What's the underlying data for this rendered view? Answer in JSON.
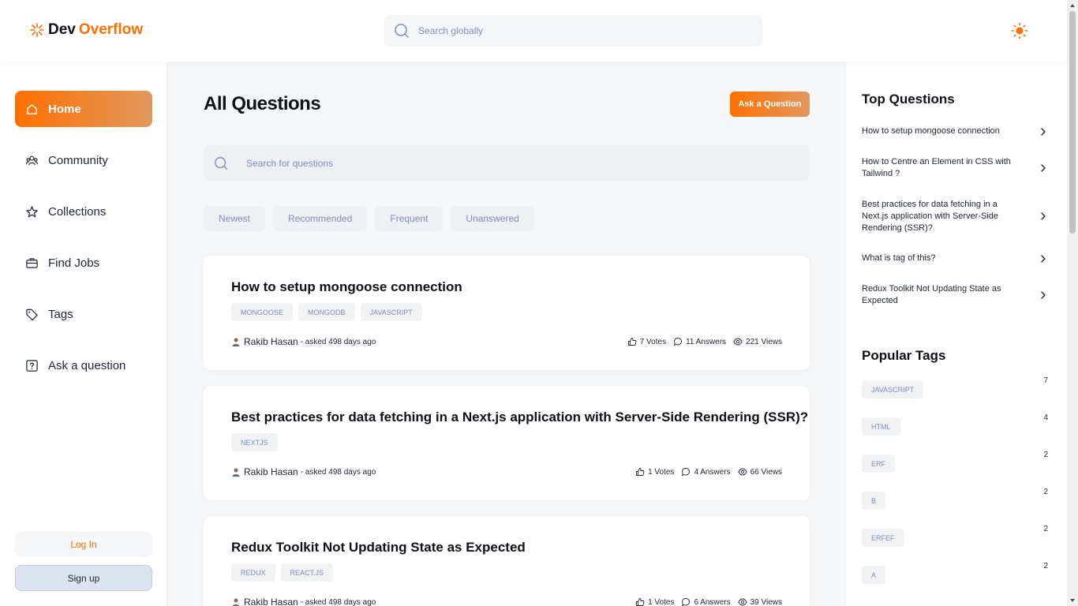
{
  "brand": {
    "part1": "Dev",
    "part2": "Overflow",
    "accent": "#ff7000"
  },
  "header": {
    "search_placeholder": "Search globally",
    "theme_icon": "sun-icon"
  },
  "sidebar": {
    "items": [
      {
        "label": "Home",
        "icon": "home-icon",
        "active": true
      },
      {
        "label": "Community",
        "icon": "users-icon"
      },
      {
        "label": "Collections",
        "icon": "star-icon"
      },
      {
        "label": "Find Jobs",
        "icon": "briefcase-icon"
      },
      {
        "label": "Tags",
        "icon": "tag-icon"
      },
      {
        "label": "Ask a question",
        "icon": "question-icon"
      }
    ],
    "login_label": "Log In",
    "signup_label": "Sign up"
  },
  "main": {
    "title": "All Questions",
    "ask_button": "Ask a Question",
    "search_placeholder": "Search for questions",
    "filters": [
      "Newest",
      "Recommended",
      "Frequent",
      "Unanswered"
    ],
    "questions": [
      {
        "title": "How to setup mongoose connection",
        "tags": [
          "MONGOOSE",
          "MONGODB",
          "JAVASCRIPT"
        ],
        "author": "Rakib Hasan",
        "asked": "- asked 498 days ago",
        "votes": "7 Votes",
        "answers": "11 Answers",
        "views": "221 Views"
      },
      {
        "title": "Best practices for data fetching in a Next.js application with Server-Side Rendering (SSR)?",
        "tags": [
          "NEXTJS"
        ],
        "author": "Rakib Hasan",
        "asked": "- asked 498 days ago",
        "votes": "1 Votes",
        "answers": "4 Answers",
        "views": "66 Views"
      },
      {
        "title": "Redux Toolkit Not Updating State as Expected",
        "tags": [
          "REDUX",
          "REACT.JS"
        ],
        "author": "Rakib Hasan",
        "asked": "- asked 498 days ago",
        "votes": "1 Votes",
        "answers": "6 Answers",
        "views": "39 Views"
      }
    ]
  },
  "right": {
    "top_title": "Top Questions",
    "top_questions": [
      "How to setup mongoose connection",
      "How to Centre an Element in CSS with Tailwind ?",
      "Best practices for data fetching in a Next.js application with Server-Side Rendering (SSR)?",
      "What is tag of this?",
      "Redux Toolkit Not Updating State as Expected"
    ],
    "tags_title": "Popular Tags",
    "popular_tags": [
      {
        "name": "JAVASCRIPT",
        "count": "7"
      },
      {
        "name": "HTML",
        "count": "4"
      },
      {
        "name": "ERF",
        "count": "2"
      },
      {
        "name": "B",
        "count": "2"
      },
      {
        "name": "ERFEF",
        "count": "2"
      },
      {
        "name": "A",
        "count": "2"
      }
    ]
  }
}
